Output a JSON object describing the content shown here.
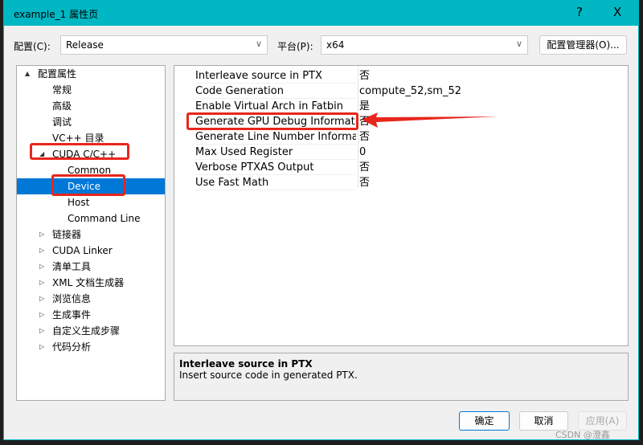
{
  "window": {
    "title": "example_1 属性页",
    "help": "?",
    "close": "X"
  },
  "config": {
    "config_label": "配置(C):",
    "config_value": "Release",
    "platform_label": "平台(P):",
    "platform_value": "x64",
    "manager_button": "配置管理器(O)..."
  },
  "tree": [
    {
      "label": "配置属性",
      "level": 0,
      "arrow": "▲"
    },
    {
      "label": "常规",
      "level": 1
    },
    {
      "label": "高级",
      "level": 1
    },
    {
      "label": "调试",
      "level": 1
    },
    {
      "label": "VC++ 目录",
      "level": 1
    },
    {
      "label": "CUDA C/C++",
      "level": 1,
      "arrow": "◢"
    },
    {
      "label": "Common",
      "level": 2
    },
    {
      "label": "Device",
      "level": 2,
      "selected": true
    },
    {
      "label": "Host",
      "level": 2
    },
    {
      "label": "Command Line",
      "level": 2
    },
    {
      "label": "链接器",
      "level": 1,
      "arrow": "▷"
    },
    {
      "label": "CUDA Linker",
      "level": 1,
      "arrow": "▷"
    },
    {
      "label": "清单工具",
      "level": 1,
      "arrow": "▷"
    },
    {
      "label": "XML 文档生成器",
      "level": 1,
      "arrow": "▷"
    },
    {
      "label": "浏览信息",
      "level": 1,
      "arrow": "▷"
    },
    {
      "label": "生成事件",
      "level": 1,
      "arrow": "▷"
    },
    {
      "label": "自定义生成步骤",
      "level": 1,
      "arrow": "▷"
    },
    {
      "label": "代码分析",
      "level": 1,
      "arrow": "▷"
    }
  ],
  "properties": [
    {
      "name": "Interleave source in PTX",
      "value": "否"
    },
    {
      "name": "Code Generation",
      "value": "compute_52,sm_52"
    },
    {
      "name": "Enable Virtual Arch in Fatbin",
      "value": "是"
    },
    {
      "name": "Generate GPU Debug Information",
      "value": "否"
    },
    {
      "name": "Generate Line Number Information",
      "value": "否"
    },
    {
      "name": "Max Used Register",
      "value": "0"
    },
    {
      "name": "Verbose PTXAS Output",
      "value": "否"
    },
    {
      "name": "Use Fast Math",
      "value": "否"
    }
  ],
  "description": {
    "title": "Interleave source in PTX",
    "text": "Insert source code in generated PTX."
  },
  "buttons": {
    "ok": "确定",
    "cancel": "取消",
    "apply": "应用(A)"
  },
  "watermark": "CSDN @澄鑫",
  "annotation_color": "#e8261c",
  "accent": "#0078d7",
  "titlebar_color": "#00b7c3"
}
